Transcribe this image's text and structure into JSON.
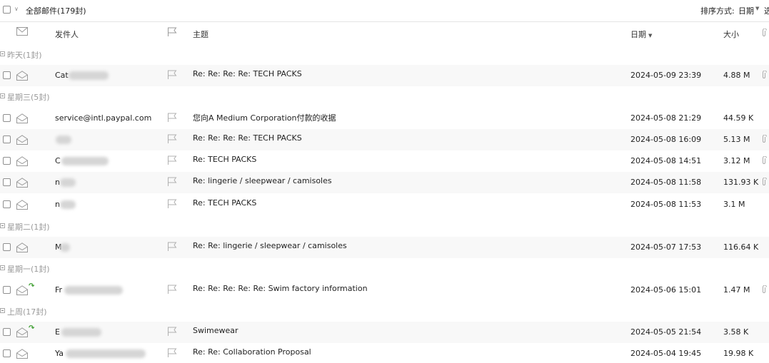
{
  "toolbar": {
    "all_mail_label": "全部邮件(179封)",
    "sort_label": "排序方式:",
    "sort_value": "日期",
    "cut_text": "选"
  },
  "columns": {
    "sender": "发件人",
    "subject": "主题",
    "date": "日期",
    "size": "大小"
  },
  "groups": [
    {
      "label": "昨天(1封)"
    },
    {
      "label": "星期三(5封)"
    },
    {
      "label": "星期二(1封)"
    },
    {
      "label": "星期一(1封)"
    },
    {
      "label": "上周(17封)"
    }
  ],
  "emails": [
    {
      "sender": "Cat",
      "subject": "Re: Re: Re: Re: TECH PACKS",
      "date": "2024-05-09 23:39",
      "size": "4.88 M",
      "attachment": true,
      "forwarded": false
    },
    {
      "sender": "service@intl.paypal.com",
      "subject": "您向A Medium Corporation付款的收据",
      "date": "2024-05-08 21:29",
      "size": "44.59 K",
      "attachment": false,
      "forwarded": false
    },
    {
      "sender": "",
      "subject": "Re: Re: Re: Re: TECH PACKS",
      "date": "2024-05-08 16:09",
      "size": "5.13 M",
      "attachment": true,
      "forwarded": false
    },
    {
      "sender": "C",
      "subject": "Re: TECH PACKS",
      "date": "2024-05-08 14:51",
      "size": "3.12 M",
      "attachment": true,
      "forwarded": false
    },
    {
      "sender": "n",
      "subject": "Re: lingerie / sleepwear / camisoles",
      "date": "2024-05-08 11:58",
      "size": "131.93 K",
      "attachment": true,
      "forwarded": false
    },
    {
      "sender": "n",
      "subject": "Re: TECH PACKS",
      "date": "2024-05-08 11:53",
      "size": "3.1 M",
      "attachment": false,
      "forwarded": false
    },
    {
      "sender": "M",
      "subject": "Re: Re: lingerie / sleepwear / camisoles",
      "date": "2024-05-07 17:53",
      "size": "116.64 K",
      "attachment": false,
      "forwarded": false
    },
    {
      "sender": "Fr",
      "subject": "Re: Re: Re: Re: Re: Swim factory information",
      "date": "2024-05-06 15:01",
      "size": "1.47 M",
      "attachment": true,
      "forwarded": true
    },
    {
      "sender": "E",
      "subject": "Swimewear",
      "date": "2024-05-05 21:54",
      "size": "3.58 K",
      "attachment": false,
      "forwarded": true
    },
    {
      "sender": "Ya",
      "subject": "Re: Re: Collaboration Proposal",
      "date": "2024-05-04 19:45",
      "size": "19.98 K",
      "attachment": false,
      "forwarded": false
    }
  ]
}
